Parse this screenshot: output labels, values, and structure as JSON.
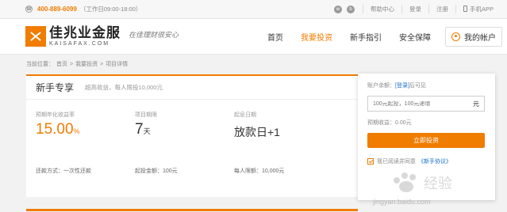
{
  "topbar": {
    "phone": "400-889-6099",
    "hours": "（工作日09:00-18:00）",
    "links": [
      "帮助中心",
      "登录",
      "注册",
      "手机APP"
    ]
  },
  "header": {
    "logo_cn": "佳兆业金服",
    "logo_en": "KAISAFAX.COM",
    "slogan": "在佳理财很安心",
    "nav": [
      "首页",
      "我要投资",
      "新手指引",
      "安全保障"
    ],
    "active_nav": "我要投资",
    "account": "我的帐户"
  },
  "breadcrumb": {
    "label": "当前位置：",
    "items": [
      "首页",
      ">",
      "我要投资",
      ">",
      "项目详情"
    ]
  },
  "product": {
    "title": "新手专享",
    "subtitle": "超高收益，每人限投10,000元",
    "rate_label": "预期年化收益率",
    "rate_value": "15.00",
    "rate_unit": "%",
    "term_label": "项目期限",
    "term_value": "7",
    "term_unit": "天",
    "start_label": "起息日期",
    "start_value": "放款日+1",
    "repay": "还款方式：一次性还款",
    "min_amount": "起投金额：100元",
    "limit": "每人限额：10,000元"
  },
  "invest": {
    "balance_prefix": "账户余额：",
    "login": "[登录]",
    "balance_suffix": "后可见",
    "input_placeholder": "100元起投，100元递增",
    "unit": "元",
    "expected": "预期收益：0.00元",
    "button": "立即投资",
    "agree_text": "我已阅读并同意",
    "agree_link": "《新手协议》"
  },
  "watermark": {
    "text": "jingyan.baidu.com",
    "brand": "经验"
  },
  "colors": {
    "accent": "#f07c00",
    "link": "#1a6fc9"
  }
}
